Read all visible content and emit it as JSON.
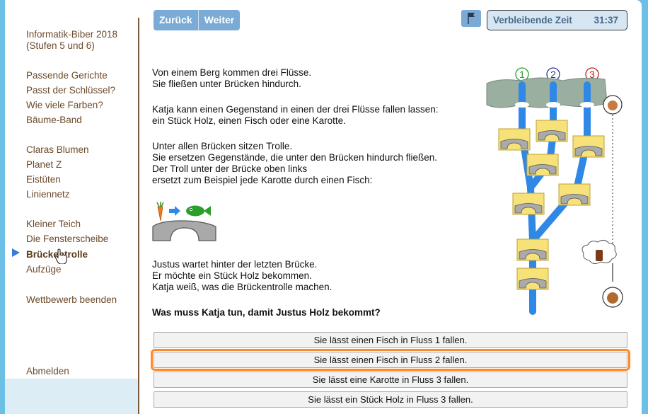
{
  "sidebar": {
    "title_line1": "Informatik-Biber 2018",
    "title_line2": "(Stufen 5 und 6)",
    "items": [
      "Passende Gerichte",
      "Passt der Schlüssel?",
      "Wie viele Farben?",
      "Bäume-Band",
      "Claras Blumen",
      "Planet Z",
      "Eistüten",
      "Liniennetz",
      "Kleiner Teich",
      "Die Fensterscheibe",
      "Brückentrolle",
      "Aufzüge"
    ],
    "active_index": 10,
    "end_label": "Wettbewerb beenden",
    "logout_label": "Abmelden"
  },
  "nav": {
    "back": "Zurück",
    "next": "Weiter"
  },
  "timer": {
    "label": "Verbleibende Zeit",
    "value": "31:37"
  },
  "question": {
    "p1": [
      "Von einem Berg kommen drei Flüsse.",
      "Sie fließen unter Brücken hindurch."
    ],
    "p2": [
      "Katja kann einen Gegenstand in einen der drei Flüsse fallen lassen:",
      "ein Stück Holz, einen Fisch oder eine Karotte."
    ],
    "p3": [
      "Unter allen Brücken sitzen Trolle.",
      "Sie ersetzen Gegenstände, die unter den Brücken hindurch fließen.",
      "Der Troll unter der Brücke oben links",
      "ersetzt zum Beispiel jede Karotte durch einen Fisch:"
    ],
    "p4": [
      "Justus wartet hinter der letzten Brücke.",
      "Er möchte ein Stück Holz bekommen.",
      "Katja weiß, was die Brückentrolle machen."
    ],
    "prompt": "Was muss Katja tun, damit Justus Holz bekommt?"
  },
  "river_numbers": [
    "1",
    "2",
    "3"
  ],
  "answers": [
    "Sie lässt einen Fisch in Fluss 1 fallen.",
    "Sie lässt einen Fisch in Fluss 2 fallen.",
    "Sie lässt eine Karotte in Fluss 3 fallen.",
    "Sie lässt ein Stück Holz in Fluss 3 fallen."
  ],
  "selected_answer": 1,
  "colors": {
    "river": "#2f88e6",
    "carrot": "#f07a1a",
    "fish": "#2aa02a",
    "wood": "#7a3a1a",
    "highlight": "#ff8a2a"
  }
}
